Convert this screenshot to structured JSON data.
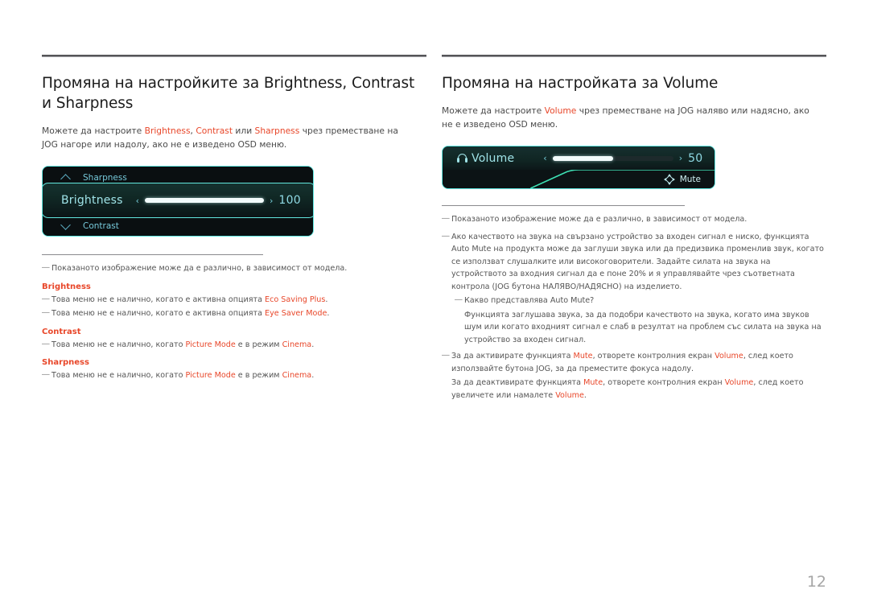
{
  "page": {
    "number": "12"
  },
  "left": {
    "heading": "Промяна на настройките за Brightness, Contrast и Sharpness",
    "intro_parts": {
      "p1": "Можете да настроите ",
      "kw1": "Brightness",
      "p2": ", ",
      "kw2": "Contrast",
      "p3": " или ",
      "kw3": "Sharpness",
      "p4": " чрез преместване на JOG нагоре или надолу, ако не е изведено OSD меню."
    },
    "osd": {
      "row_sharpness": {
        "icon": "chevron-up-icon",
        "label": "Sharpness"
      },
      "row_brightness": {
        "label": "Brightness",
        "left_arrow": "‹",
        "right_arrow": "›",
        "value": "100",
        "fill_percent": 100
      },
      "row_contrast": {
        "icon": "chevron-down-icon",
        "label": "Contrast"
      }
    },
    "notes": {
      "general": "Показаното изображение може да е различно, в зависимост от модела.",
      "sections": [
        {
          "title": "Brightness",
          "items": [
            {
              "pre": "Това меню не е налично, когато е активна опцията ",
              "kw": "Eco Saving Plus",
              "post": "."
            },
            {
              "pre": "Това меню не е налично, когато е активна опцията ",
              "kw": "Eye Saver Mode",
              "post": "."
            }
          ]
        },
        {
          "title": "Contrast",
          "items": [
            {
              "pre": "Това меню не е налично, когато ",
              "kw": "Picture Mode",
              "mid": " е в режим ",
              "kw2": "Cinema",
              "post": "."
            }
          ]
        },
        {
          "title": "Sharpness",
          "items": [
            {
              "pre": "Това меню не е налично, когато ",
              "kw": "Picture Mode",
              "mid": " е в режим ",
              "kw2": "Cinema",
              "post": "."
            }
          ]
        }
      ]
    }
  },
  "right": {
    "heading": "Промяна на настройката за Volume",
    "intro_parts": {
      "p1": "Можете да настроите ",
      "kw1": "Volume",
      "p2": " чрез преместване на JOG наляво или надясно, ако не е изведено OSD меню."
    },
    "osd": {
      "volume_row": {
        "icon": "headphone-icon",
        "label": "Volume",
        "left_arrow": "‹",
        "right_arrow": "›",
        "value": "50",
        "fill_percent": 50
      },
      "mute_row": {
        "icon": "dpad-icon",
        "label": "Mute"
      }
    },
    "notes": {
      "n1": "Показаното изображение може да е различно, в зависимост от модела.",
      "n2": "Ако качеството на звука на свързано устройство за входен сигнал е ниско, функцията Auto Mute на продукта може да заглуши звука или да предизвика променлив звук, когато се използват слушалките или високоговорители. Задайте силата на звука на устройството за входния сигнал да е поне 20% и я управлявайте чрез съответната контрола (JOG бутона НАЛЯВО/НАДЯСНО) на изделието.",
      "n2_sub": "Какво представлява Auto Mute?",
      "n2_sub_body": "Функцията заглушава звука, за да подобри качеството на звука, когато има звуков шум или когато входният сигнал е слаб в резултат на проблем със силата на звука на устройство за входен сигнал.",
      "n3_a": "За да активирате функцията ",
      "n3_kw1": "Mute",
      "n3_b": ", отворете контролния екран ",
      "n3_kw2": "Volume",
      "n3_c": ", след което използвайте бутона JOG, за да преместите фокуса надолу.",
      "n3_d": "За да деактивирате функцията ",
      "n3_kw3": "Mute",
      "n3_e": ", отворете контролния екран ",
      "n3_kw4": "Volume",
      "n3_f": ", след което увеличете или намалете ",
      "n3_kw5": "Volume",
      "n3_g": "."
    }
  }
}
